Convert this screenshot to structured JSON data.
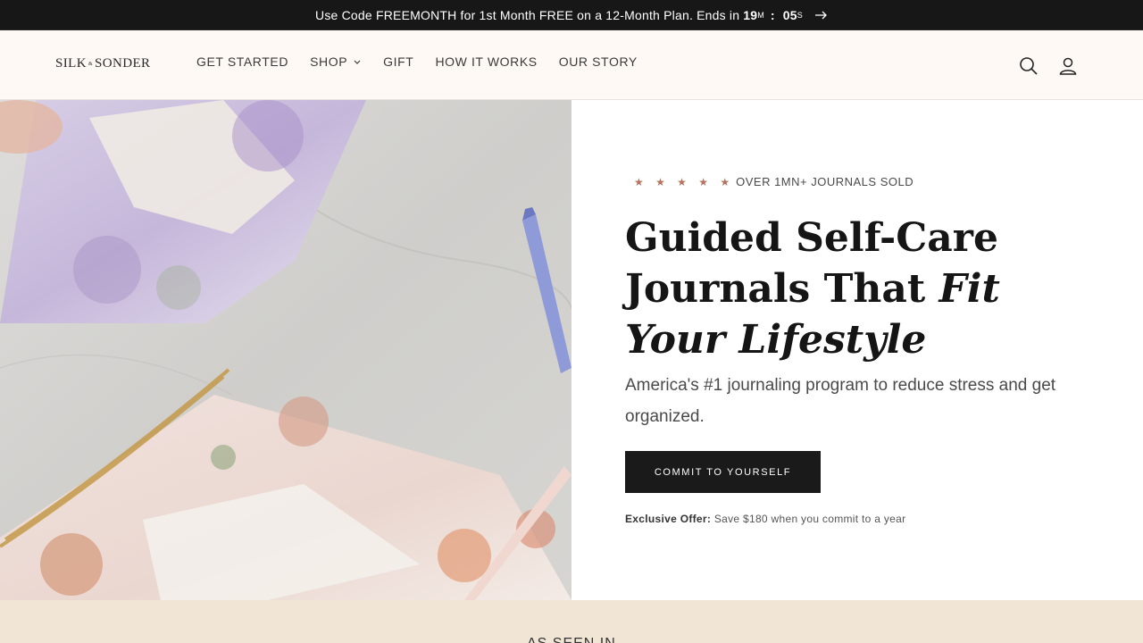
{
  "announcement": {
    "text": "Use Code FREEMONTH for 1st Month FREE on a 12-Month Plan. Ends in",
    "minutes": "19",
    "minutes_unit": "M",
    "separator": ":",
    "seconds": "05",
    "seconds_unit": "S",
    "arrow_icon": "arrow-right-icon"
  },
  "header": {
    "logo": {
      "left": "SILK",
      "amp": "&",
      "right": "SONDER"
    },
    "nav": [
      {
        "label": "GET STARTED"
      },
      {
        "label": "SHOP",
        "icon": "chevron-down-icon"
      },
      {
        "label": "GIFT"
      },
      {
        "label": "HOW IT WORKS"
      },
      {
        "label": "OUR STORY"
      }
    ],
    "icons": [
      "search-icon",
      "account-icon"
    ]
  },
  "hero": {
    "stars": "★ ★ ★ ★ ★",
    "rating_text": "OVER 1MN+ JOURNALS SOLD",
    "headline_plain": "Guided Self-Care Journals That ",
    "headline_italic": "Fit Your Lifestyle",
    "subheadline": "America's #1 journaling program to reduce stress and get organized.",
    "cta_label": "COMMIT TO YOURSELF",
    "offer_label": "Exclusive Offer:",
    "offer_text": "Save $180 when you commit to a year"
  },
  "band": {
    "text": "AS SEEN IN"
  },
  "colors": {
    "announcement_bg": "#171717",
    "header_bg": "#fff9f5",
    "star": "#b4735c",
    "cta_bg": "#1a1a1a",
    "band_bg": "#f1e6d6"
  }
}
